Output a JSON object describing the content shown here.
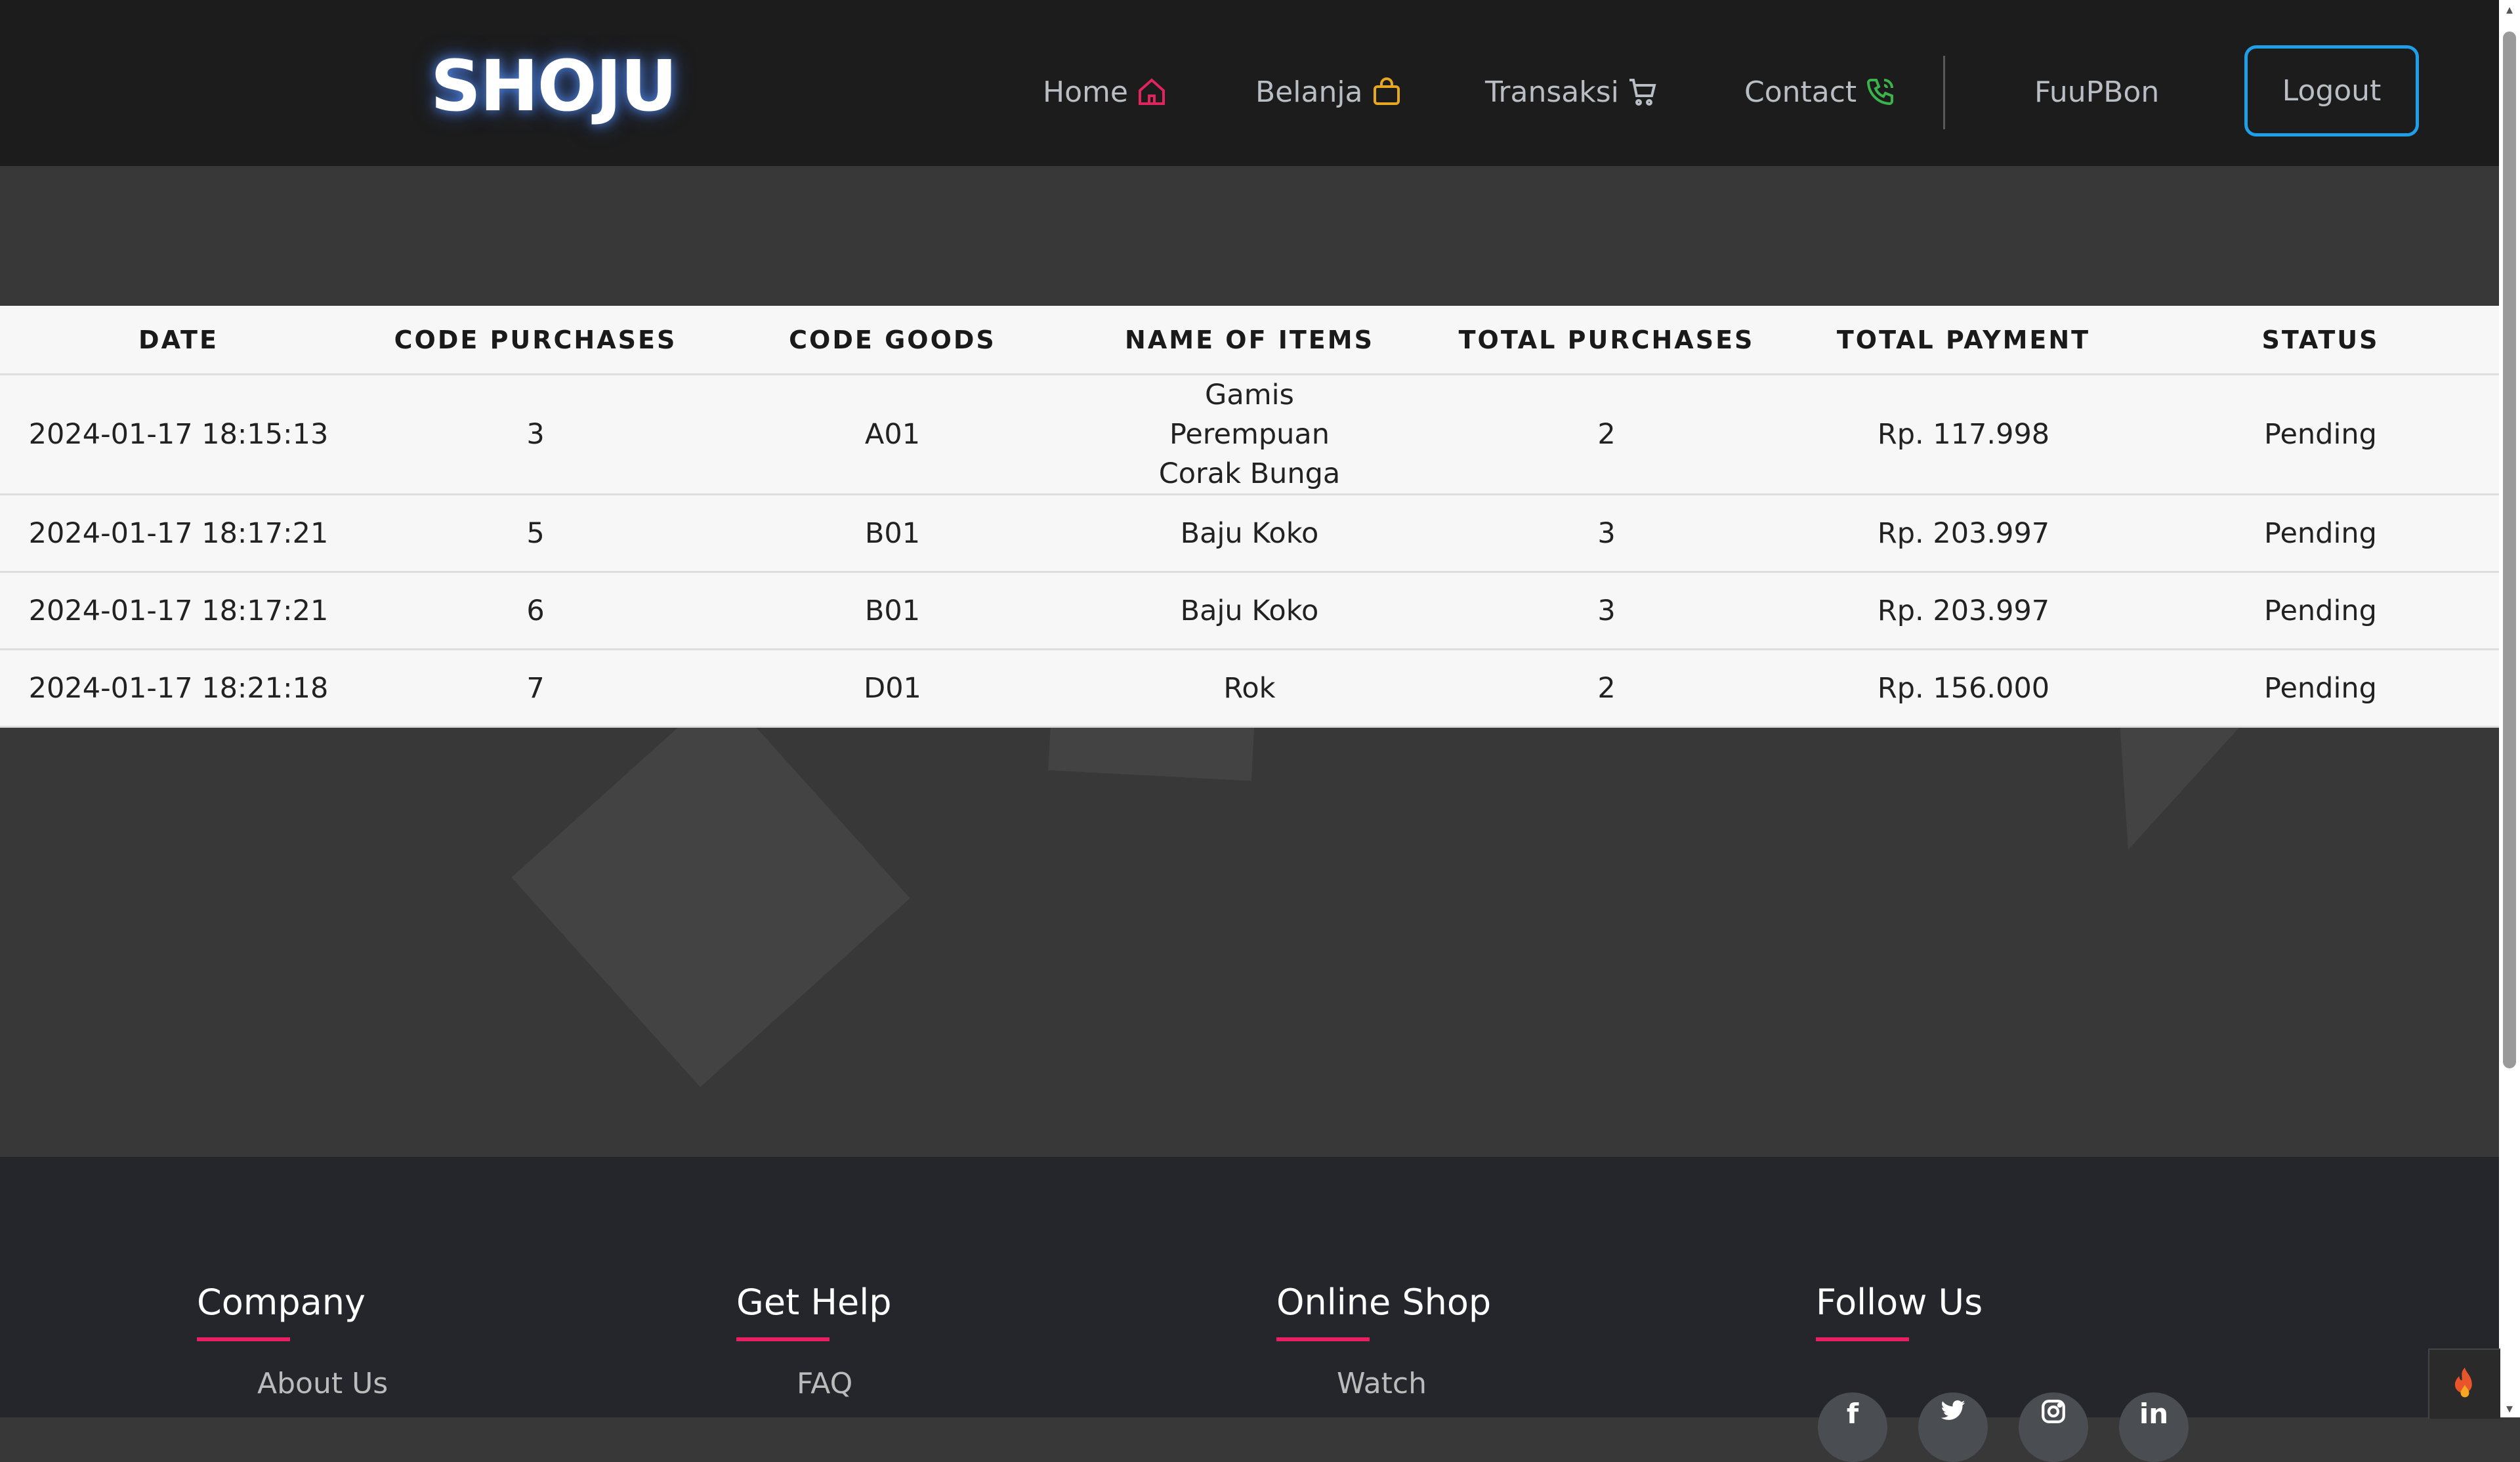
{
  "brand": "SHOJU",
  "nav": {
    "items": [
      {
        "label": "Home",
        "icon": "home-icon",
        "icon_color": "#e0245e"
      },
      {
        "label": "Belanja",
        "icon": "shopping-bag-icon",
        "icon_color": "#e6a820"
      },
      {
        "label": "Transaksi",
        "icon": "cart-icon",
        "icon_color": "#b9bec4"
      },
      {
        "label": "Contact",
        "icon": "phone-icon",
        "icon_color": "#3bb34a"
      }
    ],
    "user": "FuuPBon",
    "logout": "Logout"
  },
  "table": {
    "headers": [
      "DATE",
      "CODE PURCHASES",
      "CODE GOODS",
      "NAME OF ITEMS",
      "TOTAL PURCHASES",
      "TOTAL PAYMENT",
      "STATUS"
    ],
    "rows": [
      {
        "date": "2024-01-17 18:15:13",
        "code_purchase": "3",
        "code_goods": "A01",
        "name": "Gamis Perempuan Corak Bunga",
        "total_purchases": "2",
        "total_payment": "Rp. 117.998",
        "status": "Pending"
      },
      {
        "date": "2024-01-17 18:17:21",
        "code_purchase": "5",
        "code_goods": "B01",
        "name": "Baju Koko",
        "total_purchases": "3",
        "total_payment": "Rp. 203.997",
        "status": "Pending"
      },
      {
        "date": "2024-01-17 18:17:21",
        "code_purchase": "6",
        "code_goods": "B01",
        "name": "Baju Koko",
        "total_purchases": "3",
        "total_payment": "Rp. 203.997",
        "status": "Pending"
      },
      {
        "date": "2024-01-17 18:21:18",
        "code_purchase": "7",
        "code_goods": "D01",
        "name": "Rok",
        "total_purchases": "2",
        "total_payment": "Rp. 156.000",
        "status": "Pending"
      }
    ]
  },
  "footer": {
    "columns": [
      {
        "title": "Company",
        "first_link": "About Us"
      },
      {
        "title": "Get Help",
        "first_link": "FAQ"
      },
      {
        "title": "Online Shop",
        "first_link": "Watch"
      },
      {
        "title": "Follow Us",
        "first_link": ""
      }
    ],
    "socials": [
      {
        "icon": "facebook-icon",
        "glyph": "f"
      },
      {
        "icon": "twitter-icon",
        "glyph": "🐦"
      },
      {
        "icon": "instagram-icon",
        "glyph": "◎"
      },
      {
        "icon": "linkedin-icon",
        "glyph": "in"
      }
    ],
    "accent": "#e91e63"
  }
}
